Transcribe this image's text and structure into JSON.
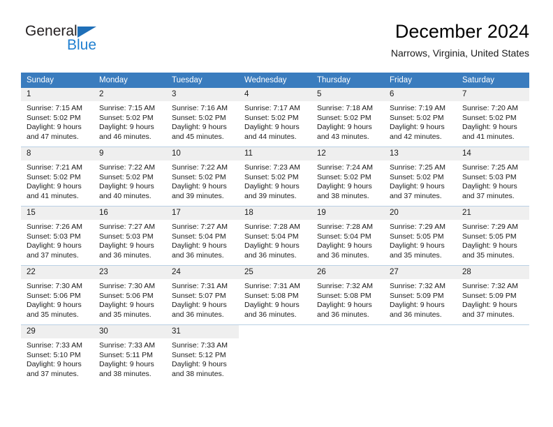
{
  "brand": {
    "name_dark": "General",
    "name_blue": "Blue",
    "accent_color": "#1f7fd0",
    "triangle_color": "#1f6fb8"
  },
  "header": {
    "title": "December 2024",
    "subtitle": "Narrows, Virginia, United States"
  },
  "theme": {
    "header_bg": "#3a7cbe",
    "header_text": "#ffffff",
    "daynum_bg": "#efefef",
    "row_divider": "#b9d0e4"
  },
  "weekdays": [
    "Sunday",
    "Monday",
    "Tuesday",
    "Wednesday",
    "Thursday",
    "Friday",
    "Saturday"
  ],
  "weeks": [
    [
      {
        "day": "1",
        "sunrise": "Sunrise: 7:15 AM",
        "sunset": "Sunset: 5:02 PM",
        "daylight1": "Daylight: 9 hours",
        "daylight2": "and 47 minutes."
      },
      {
        "day": "2",
        "sunrise": "Sunrise: 7:15 AM",
        "sunset": "Sunset: 5:02 PM",
        "daylight1": "Daylight: 9 hours",
        "daylight2": "and 46 minutes."
      },
      {
        "day": "3",
        "sunrise": "Sunrise: 7:16 AM",
        "sunset": "Sunset: 5:02 PM",
        "daylight1": "Daylight: 9 hours",
        "daylight2": "and 45 minutes."
      },
      {
        "day": "4",
        "sunrise": "Sunrise: 7:17 AM",
        "sunset": "Sunset: 5:02 PM",
        "daylight1": "Daylight: 9 hours",
        "daylight2": "and 44 minutes."
      },
      {
        "day": "5",
        "sunrise": "Sunrise: 7:18 AM",
        "sunset": "Sunset: 5:02 PM",
        "daylight1": "Daylight: 9 hours",
        "daylight2": "and 43 minutes."
      },
      {
        "day": "6",
        "sunrise": "Sunrise: 7:19 AM",
        "sunset": "Sunset: 5:02 PM",
        "daylight1": "Daylight: 9 hours",
        "daylight2": "and 42 minutes."
      },
      {
        "day": "7",
        "sunrise": "Sunrise: 7:20 AM",
        "sunset": "Sunset: 5:02 PM",
        "daylight1": "Daylight: 9 hours",
        "daylight2": "and 41 minutes."
      }
    ],
    [
      {
        "day": "8",
        "sunrise": "Sunrise: 7:21 AM",
        "sunset": "Sunset: 5:02 PM",
        "daylight1": "Daylight: 9 hours",
        "daylight2": "and 41 minutes."
      },
      {
        "day": "9",
        "sunrise": "Sunrise: 7:22 AM",
        "sunset": "Sunset: 5:02 PM",
        "daylight1": "Daylight: 9 hours",
        "daylight2": "and 40 minutes."
      },
      {
        "day": "10",
        "sunrise": "Sunrise: 7:22 AM",
        "sunset": "Sunset: 5:02 PM",
        "daylight1": "Daylight: 9 hours",
        "daylight2": "and 39 minutes."
      },
      {
        "day": "11",
        "sunrise": "Sunrise: 7:23 AM",
        "sunset": "Sunset: 5:02 PM",
        "daylight1": "Daylight: 9 hours",
        "daylight2": "and 39 minutes."
      },
      {
        "day": "12",
        "sunrise": "Sunrise: 7:24 AM",
        "sunset": "Sunset: 5:02 PM",
        "daylight1": "Daylight: 9 hours",
        "daylight2": "and 38 minutes."
      },
      {
        "day": "13",
        "sunrise": "Sunrise: 7:25 AM",
        "sunset": "Sunset: 5:02 PM",
        "daylight1": "Daylight: 9 hours",
        "daylight2": "and 37 minutes."
      },
      {
        "day": "14",
        "sunrise": "Sunrise: 7:25 AM",
        "sunset": "Sunset: 5:03 PM",
        "daylight1": "Daylight: 9 hours",
        "daylight2": "and 37 minutes."
      }
    ],
    [
      {
        "day": "15",
        "sunrise": "Sunrise: 7:26 AM",
        "sunset": "Sunset: 5:03 PM",
        "daylight1": "Daylight: 9 hours",
        "daylight2": "and 37 minutes."
      },
      {
        "day": "16",
        "sunrise": "Sunrise: 7:27 AM",
        "sunset": "Sunset: 5:03 PM",
        "daylight1": "Daylight: 9 hours",
        "daylight2": "and 36 minutes."
      },
      {
        "day": "17",
        "sunrise": "Sunrise: 7:27 AM",
        "sunset": "Sunset: 5:04 PM",
        "daylight1": "Daylight: 9 hours",
        "daylight2": "and 36 minutes."
      },
      {
        "day": "18",
        "sunrise": "Sunrise: 7:28 AM",
        "sunset": "Sunset: 5:04 PM",
        "daylight1": "Daylight: 9 hours",
        "daylight2": "and 36 minutes."
      },
      {
        "day": "19",
        "sunrise": "Sunrise: 7:28 AM",
        "sunset": "Sunset: 5:04 PM",
        "daylight1": "Daylight: 9 hours",
        "daylight2": "and 36 minutes."
      },
      {
        "day": "20",
        "sunrise": "Sunrise: 7:29 AM",
        "sunset": "Sunset: 5:05 PM",
        "daylight1": "Daylight: 9 hours",
        "daylight2": "and 35 minutes."
      },
      {
        "day": "21",
        "sunrise": "Sunrise: 7:29 AM",
        "sunset": "Sunset: 5:05 PM",
        "daylight1": "Daylight: 9 hours",
        "daylight2": "and 35 minutes."
      }
    ],
    [
      {
        "day": "22",
        "sunrise": "Sunrise: 7:30 AM",
        "sunset": "Sunset: 5:06 PM",
        "daylight1": "Daylight: 9 hours",
        "daylight2": "and 35 minutes."
      },
      {
        "day": "23",
        "sunrise": "Sunrise: 7:30 AM",
        "sunset": "Sunset: 5:06 PM",
        "daylight1": "Daylight: 9 hours",
        "daylight2": "and 35 minutes."
      },
      {
        "day": "24",
        "sunrise": "Sunrise: 7:31 AM",
        "sunset": "Sunset: 5:07 PM",
        "daylight1": "Daylight: 9 hours",
        "daylight2": "and 36 minutes."
      },
      {
        "day": "25",
        "sunrise": "Sunrise: 7:31 AM",
        "sunset": "Sunset: 5:08 PM",
        "daylight1": "Daylight: 9 hours",
        "daylight2": "and 36 minutes."
      },
      {
        "day": "26",
        "sunrise": "Sunrise: 7:32 AM",
        "sunset": "Sunset: 5:08 PM",
        "daylight1": "Daylight: 9 hours",
        "daylight2": "and 36 minutes."
      },
      {
        "day": "27",
        "sunrise": "Sunrise: 7:32 AM",
        "sunset": "Sunset: 5:09 PM",
        "daylight1": "Daylight: 9 hours",
        "daylight2": "and 36 minutes."
      },
      {
        "day": "28",
        "sunrise": "Sunrise: 7:32 AM",
        "sunset": "Sunset: 5:09 PM",
        "daylight1": "Daylight: 9 hours",
        "daylight2": "and 37 minutes."
      }
    ],
    [
      {
        "day": "29",
        "sunrise": "Sunrise: 7:33 AM",
        "sunset": "Sunset: 5:10 PM",
        "daylight1": "Daylight: 9 hours",
        "daylight2": "and 37 minutes."
      },
      {
        "day": "30",
        "sunrise": "Sunrise: 7:33 AM",
        "sunset": "Sunset: 5:11 PM",
        "daylight1": "Daylight: 9 hours",
        "daylight2": "and 38 minutes."
      },
      {
        "day": "31",
        "sunrise": "Sunrise: 7:33 AM",
        "sunset": "Sunset: 5:12 PM",
        "daylight1": "Daylight: 9 hours",
        "daylight2": "and 38 minutes."
      },
      {
        "day": "",
        "sunrise": "",
        "sunset": "",
        "daylight1": "",
        "daylight2": ""
      },
      {
        "day": "",
        "sunrise": "",
        "sunset": "",
        "daylight1": "",
        "daylight2": ""
      },
      {
        "day": "",
        "sunrise": "",
        "sunset": "",
        "daylight1": "",
        "daylight2": ""
      },
      {
        "day": "",
        "sunrise": "",
        "sunset": "",
        "daylight1": "",
        "daylight2": ""
      }
    ]
  ]
}
